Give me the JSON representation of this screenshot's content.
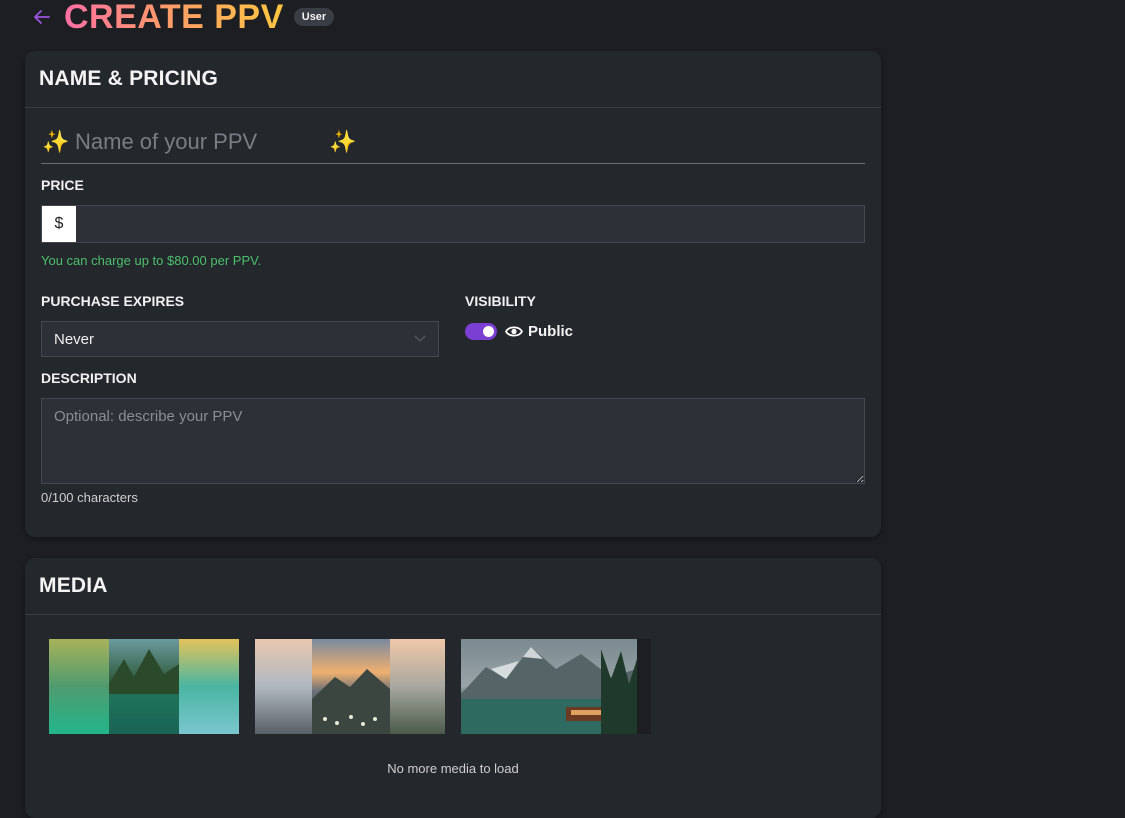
{
  "header": {
    "title": "CREATE PPV",
    "badge": "User"
  },
  "pricing_card": {
    "title": "NAME & PRICING",
    "name_placeholder": "Name of your PPV",
    "sparkle_left": "✨",
    "sparkle_right": "✨",
    "price_label": "PRICE",
    "currency_symbol": "$",
    "price_value": "",
    "price_hint": "You can charge up to $80.00 per PPV.",
    "expires_label": "PURCHASE EXPIRES",
    "expires_value": "Never",
    "visibility_label": "VISIBILITY",
    "visibility_value": "Public",
    "visibility_on": true,
    "description_label": "DESCRIPTION",
    "description_placeholder": "Optional: describe your PPV",
    "description_value": "",
    "char_count": "0/100 characters"
  },
  "media_card": {
    "title": "MEDIA",
    "thumbnails": [
      {
        "icon": "lake-forest-photo"
      },
      {
        "icon": "mountain-sunset-photo"
      },
      {
        "icon": "mountain-lake-cabin-photo"
      }
    ],
    "footer": "No more media to load"
  },
  "colors": {
    "background": "#1c1e22",
    "card": "#24272c",
    "accent": "#7b3fd4",
    "hint_green": "#4cbf6b"
  }
}
